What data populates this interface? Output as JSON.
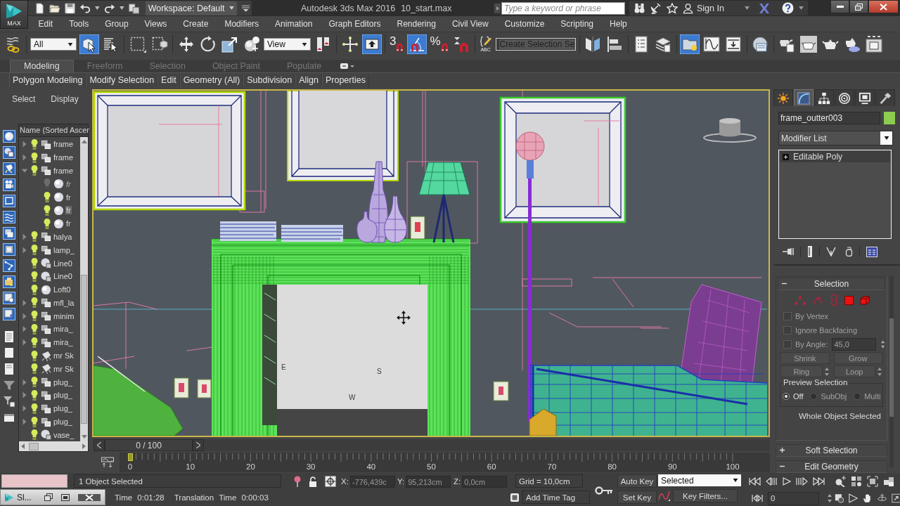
{
  "title_bar": {
    "app_button": "MAX",
    "workspace": "Workspace: Default",
    "app_title": "Autodesk 3ds Max 2016",
    "file_name": "10_start.max",
    "search": {
      "placeholder": "Type a keyword or phrase"
    },
    "sign_in": "Sign In"
  },
  "menu_bar": [
    "Edit",
    "Tools",
    "Group",
    "Views",
    "Create",
    "Modifiers",
    "Animation",
    "Graph Editors",
    "Rendering",
    "Civil View",
    "Customize",
    "Scripting",
    "Help"
  ],
  "main_toolbar": {
    "selection_filter": "All",
    "reference_coordinate_system": "View",
    "snap_toggle": "3",
    "percent_snap": "%",
    "named_selection_label": "ABC",
    "named_selection_set": "Create Selection Se",
    "tools": [
      {
        "selected": false
      },
      {
        "selected": true
      },
      {
        "selected": false
      },
      {
        "selected": false
      },
      {
        "selected": false
      },
      {
        "selected": false
      },
      {
        "selected": false
      },
      {
        "selected": false
      },
      {
        "selected": false
      },
      {
        "selected": false
      },
      {
        "selected": false
      },
      {
        "selected": true
      },
      {
        "selected": false
      },
      {
        "selected": true
      },
      {
        "selected": false
      },
      {
        "selected": false
      },
      {
        "selected": false
      },
      {
        "selected": false
      },
      {
        "selected": false
      },
      {
        "selected": false
      },
      {
        "selected": false
      },
      {
        "selected": true
      },
      {
        "selected": false
      },
      {
        "selected": false
      },
      {
        "selected": false
      },
      {
        "selected": false
      },
      {
        "selected": false
      },
      {
        "selected": false
      },
      {
        "selected": false
      },
      {
        "selected": false
      }
    ]
  },
  "ribbon": {
    "tabs": [
      {
        "label": "Modeling",
        "selected": true
      },
      {
        "label": "Freeform",
        "selected": false
      },
      {
        "label": "Selection",
        "selected": false
      },
      {
        "label": "Object Paint",
        "selected": false
      },
      {
        "label": "Populate",
        "selected": false
      }
    ],
    "panels": [
      "Polygon Modeling",
      "Modify Selection",
      "Edit",
      "Geometry (All)",
      "Subdivision",
      "Align",
      "Properties"
    ]
  },
  "scene_explorer": {
    "tabs": [
      "Select",
      "Display"
    ],
    "filters": [
      {
        "on": true
      },
      {
        "on": true
      },
      {
        "on": true
      },
      {
        "on": true
      },
      {
        "on": true
      },
      {
        "on": true
      },
      {
        "on": true
      },
      {
        "on": true
      },
      {
        "on": true
      },
      {
        "on": true
      },
      {
        "on": true
      },
      {
        "on": true
      }
    ],
    "column": "Name (Sorted Ascer",
    "items": [
      {
        "name": "frame",
        "kind": "group",
        "visible": true,
        "selected": false,
        "expanded": false
      },
      {
        "name": "frame",
        "kind": "group",
        "visible": true,
        "selected": false,
        "expanded": false
      },
      {
        "name": "frame",
        "kind": "group",
        "visible": true,
        "selected": false,
        "expanded": true,
        "children": [
          {
            "name": "fr",
            "kind": "geometry",
            "visible": false,
            "selected": false,
            "expanded": false
          },
          {
            "name": "fr",
            "kind": "geometry",
            "visible": true,
            "selected": false,
            "expanded": false
          },
          {
            "name": "fr",
            "kind": "geometry",
            "visible": true,
            "selected": true,
            "expanded": false
          },
          {
            "name": "fr",
            "kind": "geometry",
            "visible": true,
            "selected": false,
            "expanded": false
          }
        ]
      },
      {
        "name": "halya",
        "kind": "group",
        "visible": true,
        "selected": false,
        "expanded": false
      },
      {
        "name": "lamp_",
        "kind": "group",
        "visible": true,
        "selected": false,
        "expanded": false
      },
      {
        "name": "Line0",
        "kind": "shape",
        "visible": true,
        "selected": false,
        "expanded": false
      },
      {
        "name": "Line0",
        "kind": "shape",
        "visible": true,
        "selected": false,
        "expanded": false
      },
      {
        "name": "Loft0",
        "kind": "geometry",
        "visible": true,
        "selected": false,
        "expanded": false
      },
      {
        "name": "mfl_la",
        "kind": "group",
        "visible": true,
        "selected": false,
        "expanded": false
      },
      {
        "name": "minim",
        "kind": "group",
        "visible": true,
        "selected": false,
        "expanded": false
      },
      {
        "name": "mira_",
        "kind": "group",
        "visible": true,
        "selected": false,
        "expanded": false
      },
      {
        "name": "mira_",
        "kind": "group",
        "visible": true,
        "selected": false,
        "expanded": false
      },
      {
        "name": "mr Sk",
        "kind": "light",
        "visible": true,
        "selected": false,
        "expanded": false
      },
      {
        "name": "mr Sk",
        "kind": "light",
        "visible": true,
        "selected": false,
        "expanded": false
      },
      {
        "name": "plug_",
        "kind": "group",
        "visible": true,
        "selected": false,
        "expanded": false
      },
      {
        "name": "plug_",
        "kind": "group",
        "visible": true,
        "selected": false,
        "expanded": false
      },
      {
        "name": "plug_",
        "kind": "group",
        "visible": true,
        "selected": false,
        "expanded": false
      },
      {
        "name": "plug_",
        "kind": "group",
        "visible": true,
        "selected": false,
        "expanded": false
      },
      {
        "name": "vase_",
        "kind": "shape",
        "visible": true,
        "selected": false,
        "expanded": false
      }
    ]
  },
  "viewport": {
    "active": true,
    "compass_labels": [
      "E",
      "S",
      "W"
    ]
  },
  "command_panel": {
    "tabs": [
      {
        "selected": false
      },
      {
        "selected": true
      },
      {
        "selected": false
      },
      {
        "selected": false
      },
      {
        "selected": false
      },
      {
        "selected": false
      }
    ],
    "object": {
      "name": "frame_outter003",
      "color": "#8ccc4e"
    },
    "modifier_list": "Modifier List",
    "stack": [
      {
        "label": "Editable Poly",
        "expanded": false
      }
    ],
    "selection_rollout": {
      "title": "Selection",
      "expanded": true,
      "options": [
        {
          "label": "By Vertex",
          "checked": false,
          "disabled": true
        },
        {
          "label": "Ignore Backfacing",
          "checked": false,
          "disabled": true
        },
        {
          "label": "By Angle:",
          "checked": false,
          "disabled": true,
          "value": "45,0"
        }
      ],
      "buttons": [
        {
          "label": "Shrink",
          "disabled": true,
          "spinner": false
        },
        {
          "label": "Grow",
          "disabled": true,
          "spinner": false
        },
        {
          "label": "Ring",
          "disabled": true,
          "spinner": true
        },
        {
          "label": "Loop",
          "disabled": true,
          "spinner": true
        }
      ],
      "preview": {
        "title": "Preview Selection",
        "options": [
          {
            "label": "Off",
            "selected": true,
            "disabled": false
          },
          {
            "label": "SubObj",
            "selected": false,
            "disabled": true
          },
          {
            "label": "Multi",
            "selected": false,
            "disabled": true
          }
        ]
      },
      "status": "Whole Object Selected"
    },
    "rollouts": [
      {
        "title": "Soft Selection",
        "expanded": false
      },
      {
        "title": "Edit Geometry",
        "expanded": true
      }
    ]
  },
  "timeline": {
    "slider": "0 / 100",
    "level": 0,
    "ticks": [
      "0",
      "10",
      "20",
      "30",
      "40",
      "50",
      "60",
      "70",
      "80",
      "90",
      "100"
    ]
  },
  "status_bar": {
    "selection": "1 Object Selected",
    "prompt": [
      "Time 0:01:28",
      "Translation Time 0:00:03"
    ],
    "coordinates": [
      {
        "axis": "X:",
        "value": "-776,439c"
      },
      {
        "axis": "Y:",
        "value": "95,213cm"
      },
      {
        "axis": "Z:",
        "value": "0,0cm"
      }
    ],
    "grid": "Grid = 10,0cm",
    "time_tag": "Add Time Tag",
    "auto_key": {
      "label": "Auto Key",
      "on": false
    },
    "set_key": "Set Key",
    "key_mode": "Selected",
    "key_filters": "Key Filters...",
    "current_frame": "0"
  },
  "minimized_window": {
    "title": "Sl..."
  }
}
